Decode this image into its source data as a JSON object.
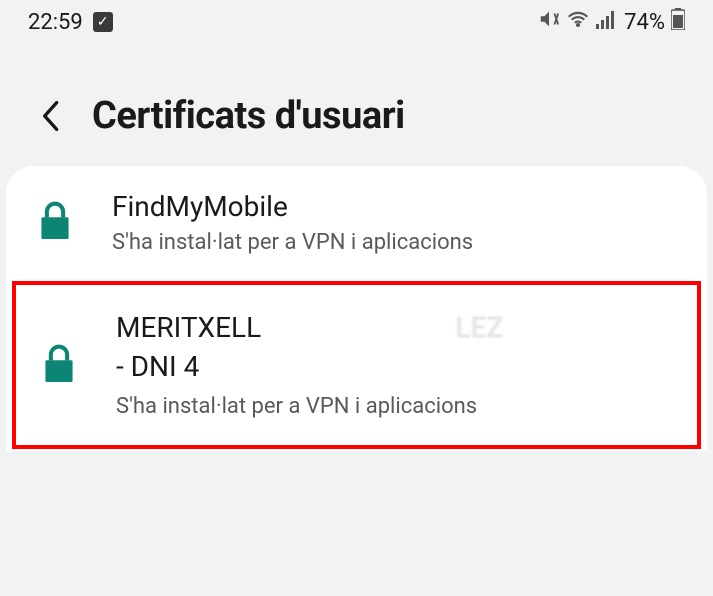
{
  "status_bar": {
    "time": "22:59",
    "battery_pct": "74%"
  },
  "header": {
    "title": "Certificats d'usuari"
  },
  "certificates": [
    {
      "title": "FindMyMobile",
      "title_line2": "",
      "subtitle": "S'ha instal·lat per a VPN i aplicacions"
    },
    {
      "title": "MERITXELL",
      "title_redacted_suffix": "LEZ",
      "title_line2": "- DNI 4",
      "subtitle": "S'ha instal·lat per a VPN i aplicacions"
    }
  ]
}
